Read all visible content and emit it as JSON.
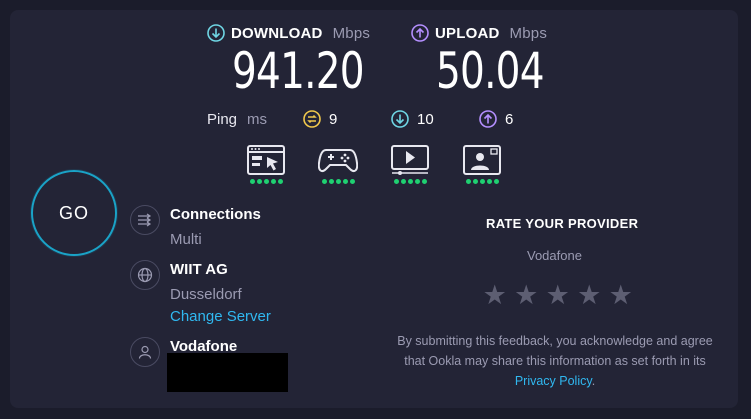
{
  "download": {
    "label": "DOWNLOAD",
    "unit": "Mbps",
    "value": "941.20",
    "icon": "download-arrow-icon",
    "color": "#6fd6e4"
  },
  "upload": {
    "label": "UPLOAD",
    "unit": "Mbps",
    "value": "50.04",
    "icon": "upload-arrow-icon",
    "color": "#b48fff"
  },
  "ping": {
    "label": "Ping",
    "unit": "ms",
    "idle": "9",
    "download": "10",
    "upload": "6",
    "idle_color": "#f2c94c"
  },
  "usage_icons": [
    {
      "name": "web-browsing-icon",
      "rating": 5
    },
    {
      "name": "gaming-icon",
      "rating": 5
    },
    {
      "name": "video-streaming-icon",
      "rating": 5
    },
    {
      "name": "video-chat-icon",
      "rating": 5
    }
  ],
  "go_label": "GO",
  "connections": {
    "title": "Connections",
    "value": "Multi"
  },
  "server": {
    "title": "WIIT AG",
    "location": "Dusseldorf",
    "change_link": "Change Server"
  },
  "provider": {
    "title": "Vodafone"
  },
  "rate": {
    "title": "RATE YOUR PROVIDER",
    "provider": "Vodafone",
    "stars": [
      "★",
      "★",
      "★",
      "★",
      "★"
    ],
    "disclaimer_text": "By submitting this feedback, you acknowledge and agree that Ookla may share this information as set forth in its ",
    "privacy_link": "Privacy Policy",
    "disclaimer_end": "."
  },
  "colors": {
    "accent": "#1aa3c7",
    "link": "#30b8f0",
    "good": "#1fd071",
    "background": "#232436"
  }
}
